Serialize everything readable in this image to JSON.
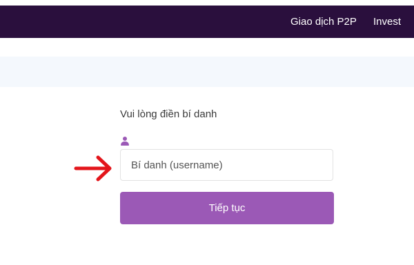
{
  "navbar": {
    "links": [
      "Giao dịch P2P",
      "Invest"
    ]
  },
  "form": {
    "label": "Vui lòng điền bí danh",
    "username_placeholder": "Bí danh (username)",
    "username_value": "",
    "submit_label": "Tiếp tục"
  },
  "colors": {
    "navbar_bg": "#2a0f3d",
    "accent": "#9b59b6",
    "subbar_bg": "#f4f8fd",
    "annotation_arrow": "#e3151b"
  },
  "icons": {
    "field_icon": "user-icon",
    "annotation": "red-arrow-icon"
  }
}
